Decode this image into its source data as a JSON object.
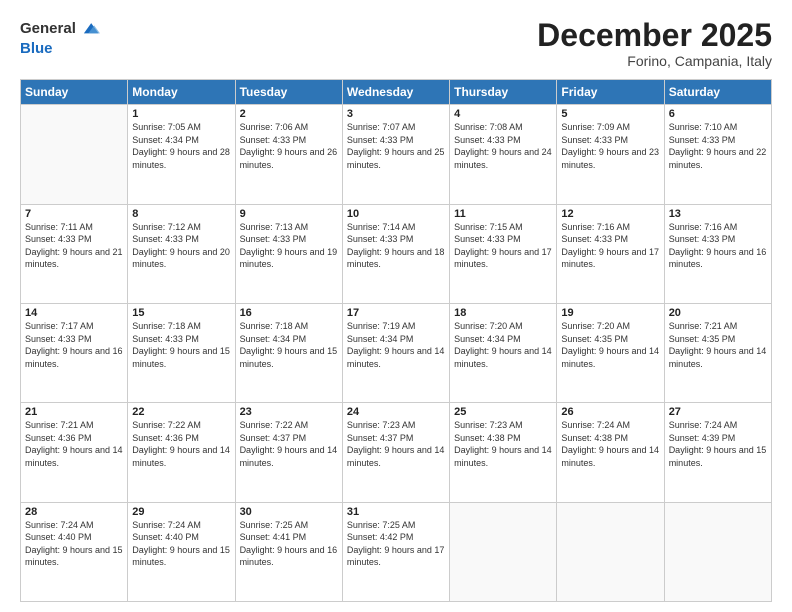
{
  "logo": {
    "general": "General",
    "blue": "Blue"
  },
  "title": "December 2025",
  "location": "Forino, Campania, Italy",
  "weekdays": [
    "Sunday",
    "Monday",
    "Tuesday",
    "Wednesday",
    "Thursday",
    "Friday",
    "Saturday"
  ],
  "weeks": [
    [
      {
        "day": null,
        "sunrise": null,
        "sunset": null,
        "daylight": null
      },
      {
        "day": "1",
        "sunrise": "Sunrise: 7:05 AM",
        "sunset": "Sunset: 4:34 PM",
        "daylight": "Daylight: 9 hours and 28 minutes."
      },
      {
        "day": "2",
        "sunrise": "Sunrise: 7:06 AM",
        "sunset": "Sunset: 4:33 PM",
        "daylight": "Daylight: 9 hours and 26 minutes."
      },
      {
        "day": "3",
        "sunrise": "Sunrise: 7:07 AM",
        "sunset": "Sunset: 4:33 PM",
        "daylight": "Daylight: 9 hours and 25 minutes."
      },
      {
        "day": "4",
        "sunrise": "Sunrise: 7:08 AM",
        "sunset": "Sunset: 4:33 PM",
        "daylight": "Daylight: 9 hours and 24 minutes."
      },
      {
        "day": "5",
        "sunrise": "Sunrise: 7:09 AM",
        "sunset": "Sunset: 4:33 PM",
        "daylight": "Daylight: 9 hours and 23 minutes."
      },
      {
        "day": "6",
        "sunrise": "Sunrise: 7:10 AM",
        "sunset": "Sunset: 4:33 PM",
        "daylight": "Daylight: 9 hours and 22 minutes."
      }
    ],
    [
      {
        "day": "7",
        "sunrise": "Sunrise: 7:11 AM",
        "sunset": "Sunset: 4:33 PM",
        "daylight": "Daylight: 9 hours and 21 minutes."
      },
      {
        "day": "8",
        "sunrise": "Sunrise: 7:12 AM",
        "sunset": "Sunset: 4:33 PM",
        "daylight": "Daylight: 9 hours and 20 minutes."
      },
      {
        "day": "9",
        "sunrise": "Sunrise: 7:13 AM",
        "sunset": "Sunset: 4:33 PM",
        "daylight": "Daylight: 9 hours and 19 minutes."
      },
      {
        "day": "10",
        "sunrise": "Sunrise: 7:14 AM",
        "sunset": "Sunset: 4:33 PM",
        "daylight": "Daylight: 9 hours and 18 minutes."
      },
      {
        "day": "11",
        "sunrise": "Sunrise: 7:15 AM",
        "sunset": "Sunset: 4:33 PM",
        "daylight": "Daylight: 9 hours and 17 minutes."
      },
      {
        "day": "12",
        "sunrise": "Sunrise: 7:16 AM",
        "sunset": "Sunset: 4:33 PM",
        "daylight": "Daylight: 9 hours and 17 minutes."
      },
      {
        "day": "13",
        "sunrise": "Sunrise: 7:16 AM",
        "sunset": "Sunset: 4:33 PM",
        "daylight": "Daylight: 9 hours and 16 minutes."
      }
    ],
    [
      {
        "day": "14",
        "sunrise": "Sunrise: 7:17 AM",
        "sunset": "Sunset: 4:33 PM",
        "daylight": "Daylight: 9 hours and 16 minutes."
      },
      {
        "day": "15",
        "sunrise": "Sunrise: 7:18 AM",
        "sunset": "Sunset: 4:33 PM",
        "daylight": "Daylight: 9 hours and 15 minutes."
      },
      {
        "day": "16",
        "sunrise": "Sunrise: 7:18 AM",
        "sunset": "Sunset: 4:34 PM",
        "daylight": "Daylight: 9 hours and 15 minutes."
      },
      {
        "day": "17",
        "sunrise": "Sunrise: 7:19 AM",
        "sunset": "Sunset: 4:34 PM",
        "daylight": "Daylight: 9 hours and 14 minutes."
      },
      {
        "day": "18",
        "sunrise": "Sunrise: 7:20 AM",
        "sunset": "Sunset: 4:34 PM",
        "daylight": "Daylight: 9 hours and 14 minutes."
      },
      {
        "day": "19",
        "sunrise": "Sunrise: 7:20 AM",
        "sunset": "Sunset: 4:35 PM",
        "daylight": "Daylight: 9 hours and 14 minutes."
      },
      {
        "day": "20",
        "sunrise": "Sunrise: 7:21 AM",
        "sunset": "Sunset: 4:35 PM",
        "daylight": "Daylight: 9 hours and 14 minutes."
      }
    ],
    [
      {
        "day": "21",
        "sunrise": "Sunrise: 7:21 AM",
        "sunset": "Sunset: 4:36 PM",
        "daylight": "Daylight: 9 hours and 14 minutes."
      },
      {
        "day": "22",
        "sunrise": "Sunrise: 7:22 AM",
        "sunset": "Sunset: 4:36 PM",
        "daylight": "Daylight: 9 hours and 14 minutes."
      },
      {
        "day": "23",
        "sunrise": "Sunrise: 7:22 AM",
        "sunset": "Sunset: 4:37 PM",
        "daylight": "Daylight: 9 hours and 14 minutes."
      },
      {
        "day": "24",
        "sunrise": "Sunrise: 7:23 AM",
        "sunset": "Sunset: 4:37 PM",
        "daylight": "Daylight: 9 hours and 14 minutes."
      },
      {
        "day": "25",
        "sunrise": "Sunrise: 7:23 AM",
        "sunset": "Sunset: 4:38 PM",
        "daylight": "Daylight: 9 hours and 14 minutes."
      },
      {
        "day": "26",
        "sunrise": "Sunrise: 7:24 AM",
        "sunset": "Sunset: 4:38 PM",
        "daylight": "Daylight: 9 hours and 14 minutes."
      },
      {
        "day": "27",
        "sunrise": "Sunrise: 7:24 AM",
        "sunset": "Sunset: 4:39 PM",
        "daylight": "Daylight: 9 hours and 15 minutes."
      }
    ],
    [
      {
        "day": "28",
        "sunrise": "Sunrise: 7:24 AM",
        "sunset": "Sunset: 4:40 PM",
        "daylight": "Daylight: 9 hours and 15 minutes."
      },
      {
        "day": "29",
        "sunrise": "Sunrise: 7:24 AM",
        "sunset": "Sunset: 4:40 PM",
        "daylight": "Daylight: 9 hours and 15 minutes."
      },
      {
        "day": "30",
        "sunrise": "Sunrise: 7:25 AM",
        "sunset": "Sunset: 4:41 PM",
        "daylight": "Daylight: 9 hours and 16 minutes."
      },
      {
        "day": "31",
        "sunrise": "Sunrise: 7:25 AM",
        "sunset": "Sunset: 4:42 PM",
        "daylight": "Daylight: 9 hours and 17 minutes."
      },
      {
        "day": null,
        "sunrise": null,
        "sunset": null,
        "daylight": null
      },
      {
        "day": null,
        "sunrise": null,
        "sunset": null,
        "daylight": null
      },
      {
        "day": null,
        "sunrise": null,
        "sunset": null,
        "daylight": null
      }
    ]
  ]
}
